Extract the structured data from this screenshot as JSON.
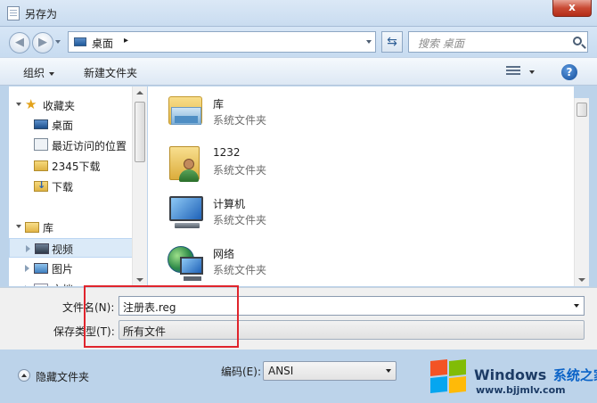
{
  "window": {
    "title": "另存为",
    "close_label": "x"
  },
  "address": {
    "location": "桌面",
    "separator": "▸",
    "search_placeholder": "搜索 桌面"
  },
  "toolbar": {
    "organize_label": "组织",
    "new_folder_label": "新建文件夹",
    "help_label": "?"
  },
  "nav_pane": {
    "items": [
      {
        "label": "收藏夹",
        "icon": "star-icon"
      },
      {
        "label": "桌面",
        "icon": "desktop-icon"
      },
      {
        "label": "最近访问的位置",
        "icon": "recent-places-icon"
      },
      {
        "label": "2345下载",
        "icon": "folder-icon"
      },
      {
        "label": "下载",
        "icon": "downloads-folder-icon"
      },
      {
        "label": "库",
        "icon": "library-icon"
      },
      {
        "label": "视频",
        "icon": "video-library-icon",
        "selected": true
      },
      {
        "label": "图片",
        "icon": "pictures-library-icon"
      },
      {
        "label": "文档",
        "icon": "documents-library-icon"
      }
    ]
  },
  "files": [
    {
      "name": "库",
      "type": "系统文件夹",
      "icon": "library-icon"
    },
    {
      "name": "1232",
      "type": "系统文件夹",
      "icon": "user-folder-icon"
    },
    {
      "name": "计算机",
      "type": "系统文件夹",
      "icon": "computer-icon"
    },
    {
      "name": "网络",
      "type": "系统文件夹",
      "icon": "network-icon"
    }
  ],
  "form": {
    "filename_label": "文件名(N):",
    "filename_value": "注册表.reg",
    "filetype_label": "保存类型(T):",
    "filetype_value": "所有文件",
    "encoding_label": "编码(E):",
    "encoding_value": "ANSI",
    "hide_folders_label": "隐藏文件夹"
  },
  "watermark": {
    "brand": "Windows",
    "brand_suffix": "系统之家",
    "url": "www.bjjmlv.com"
  },
  "colors": {
    "highlight": "#e0242c",
    "selected_bg": "#dbeaf8",
    "close_button": "#c94a34"
  }
}
